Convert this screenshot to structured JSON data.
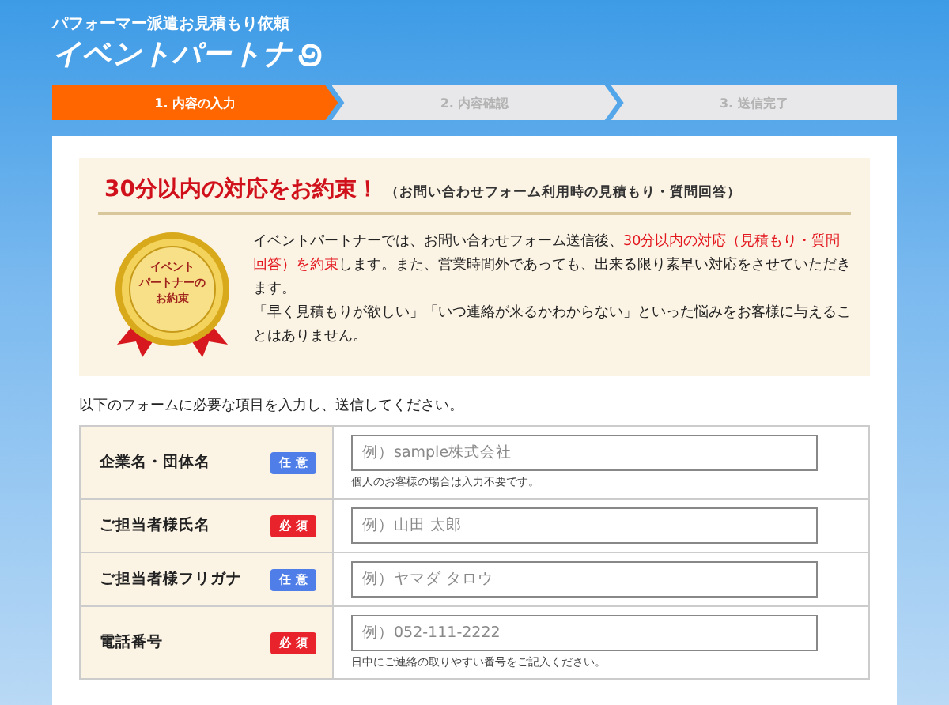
{
  "header": {
    "subtitle": "パフォーマー派遣お見積もり依頼",
    "logo": "イベントパートナ"
  },
  "steps": [
    {
      "label": "1. 内容の入力",
      "selected": true
    },
    {
      "label": "2. 内容確認",
      "selected": false
    },
    {
      "label": "3. 送信完了",
      "selected": false
    }
  ],
  "promise": {
    "heading": "30分以内の対応をお約束！",
    "note": "（お問い合わせフォーム利用時の見積もり・質問回答）",
    "medal_lines": [
      "イベント",
      "パートナーの",
      "お約束"
    ],
    "paragraphs": [
      [
        {
          "text": "イベントパートナーでは、お問い合わせフォーム送信後、",
          "emphasis": false
        },
        {
          "text": "30分以内の対応（見積もり・質問回答）を約束",
          "emphasis": true
        },
        {
          "text": "します。また、営業時間外であっても、出来る限り素早い対応をさせていただきます。",
          "emphasis": false
        }
      ],
      [
        {
          "text": "「早く見積もりが欲しい」「いつ連絡が来るかわからない」といった悩みをお客様に与えることはありません。",
          "emphasis": false
        }
      ]
    ]
  },
  "intro": "以下のフォームに必要な項目を入力し、送信してください。",
  "form_rows": [
    {
      "label": "企業名・団体名",
      "badge": "任 意",
      "required": false,
      "placeholder": "例）sample株式会社",
      "hint": "個人のお客様の場合は入力不要です。"
    },
    {
      "label": "ご担当者様氏名",
      "badge": "必 須",
      "required": true,
      "placeholder": "例）山田 太郎"
    },
    {
      "label": "ご担当者様フリガナ",
      "badge": "任 意",
      "required": false,
      "placeholder": "例）ヤマダ タロウ"
    },
    {
      "label": "電話番号",
      "badge": "必 須",
      "required": true,
      "placeholder": "例）052-111-2222",
      "hint": "日中にご連絡の取りやすい番号をご記入ください。"
    }
  ]
}
